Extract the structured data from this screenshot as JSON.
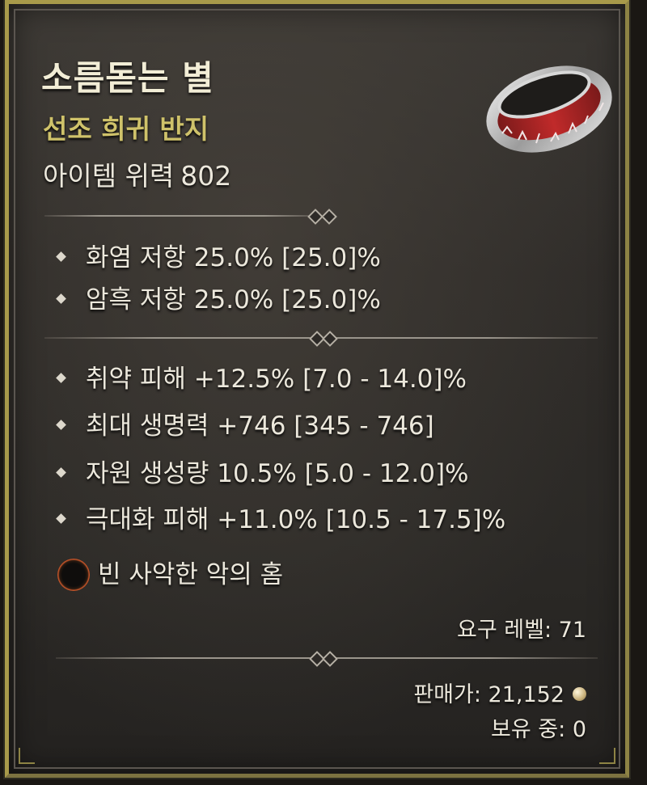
{
  "item": {
    "name": "소름돋는 별",
    "type": "선조 희귀 반지",
    "power_label": "아이템 위력",
    "power_value": "802",
    "icon": "ring-icon"
  },
  "resistances": [
    "화염 저항 25.0% [25.0]%",
    "암흑 저항 25.0% [25.0]%"
  ],
  "affixes": [
    "취약 피해 +12.5% [7.0 - 14.0]%",
    "최대 생명력 +746 [345 - 746]",
    "자원 생성량 10.5% [5.0 - 12.0]%",
    "극대화 피해 +11.0% [10.5 - 17.5]%"
  ],
  "socket": {
    "label": "빈 사악한 악의 홈",
    "icon": "socket-icon"
  },
  "requirement": "요구 레벨: 71",
  "sell_price": "판매가: 21,152",
  "owned": "보유 중: 0",
  "colors": {
    "border": "#a89a4a",
    "title": "#f2edd6",
    "rarity": "#cfc26a",
    "text": "#ece8dc",
    "background": "#2f2c29"
  }
}
